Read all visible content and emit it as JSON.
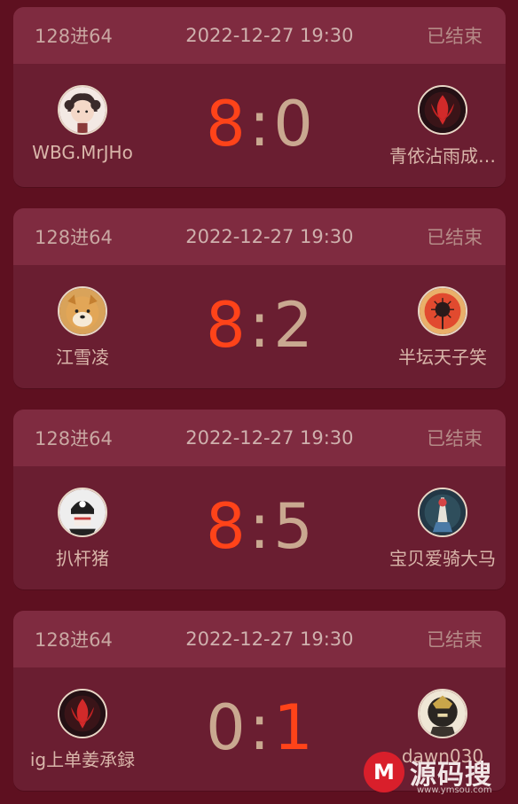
{
  "matches": [
    {
      "round": "128进64",
      "time": "2022-12-27 19:30",
      "status": "已结束",
      "left": {
        "name": "WBG.MrJHo",
        "score": "8",
        "avatar": "girl-avatar"
      },
      "right": {
        "name": "青依沾雨成…",
        "score": "0",
        "avatar": "red-emblem-avatar"
      }
    },
    {
      "round": "128进64",
      "time": "2022-12-27 19:30",
      "status": "已结束",
      "left": {
        "name": "江雪凌",
        "score": "8",
        "avatar": "shiba-avatar"
      },
      "right": {
        "name": "半坛天子笑",
        "score": "2",
        "avatar": "flower-avatar"
      }
    },
    {
      "round": "128进64",
      "time": "2022-12-27 19:30",
      "status": "已结束",
      "left": {
        "name": "扒杆猪",
        "score": "8",
        "avatar": "masked-avatar"
      },
      "right": {
        "name": "宝贝爱骑大马",
        "score": "5",
        "avatar": "warrior-avatar"
      }
    },
    {
      "round": "128进64",
      "time": "2022-12-27 19:30",
      "status": "已结束",
      "left": {
        "name": "ig上单姜承録",
        "score": "0",
        "avatar": "red-emblem-avatar"
      },
      "right": {
        "name": "dawn030",
        "score": "1",
        "avatar": "armor-avatar"
      }
    }
  ],
  "watermark": {
    "logo": "M",
    "text": "源码搜",
    "url": "www.ymsou.com"
  },
  "colors": {
    "win": "#ff4319",
    "lose": "#c9a890",
    "header": "#7f2b40",
    "card": "#6a1e31",
    "bg": "#5e1020"
  }
}
